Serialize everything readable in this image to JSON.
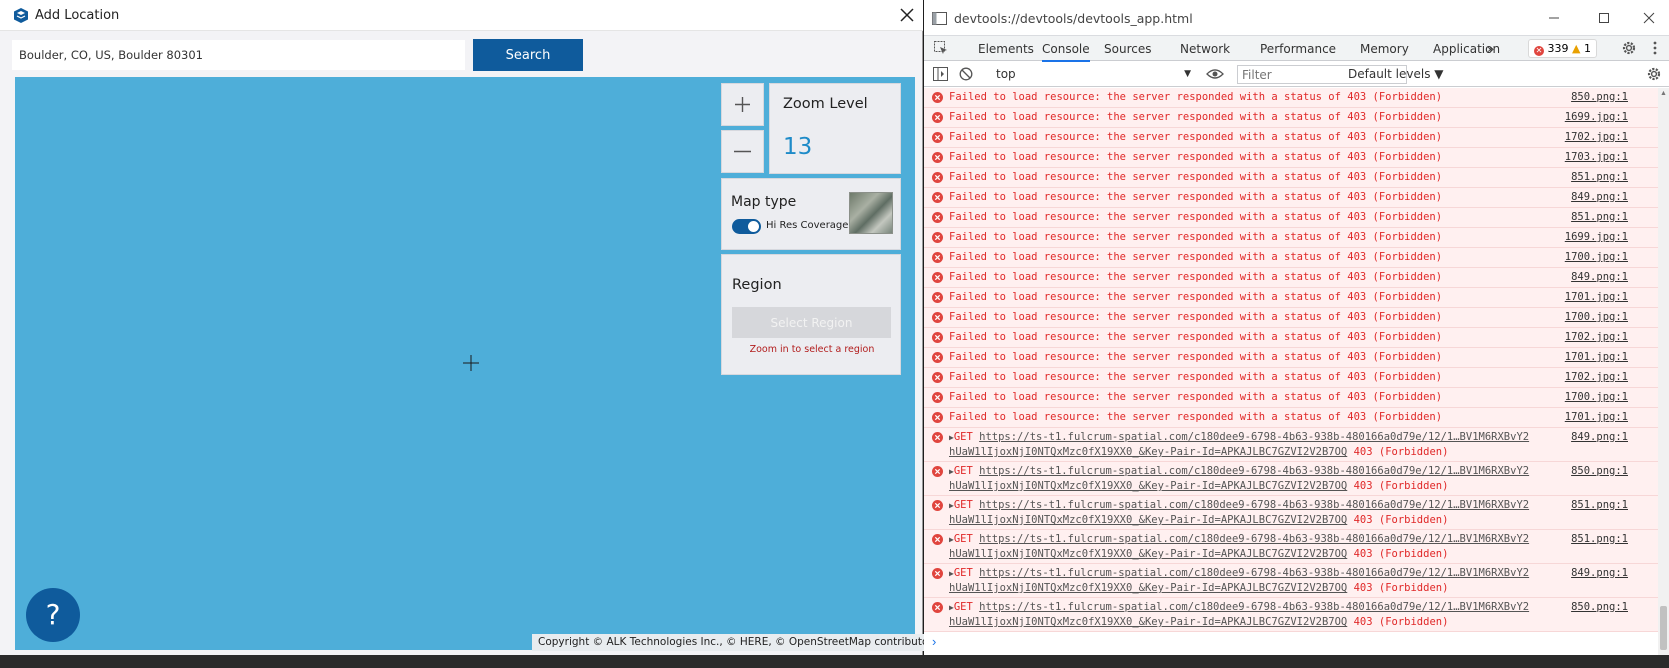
{
  "left_window": {
    "title": "Add Location",
    "search": {
      "value": "Boulder, CO, US, Boulder 80301",
      "button_label": "Search"
    },
    "zoom": {
      "in_symbol": "+",
      "out_symbol": "—",
      "label": "Zoom Level",
      "value": "13"
    },
    "map_type": {
      "label": "Map type",
      "toggle_label": "Hi Res Coverage",
      "toggle_on": true
    },
    "region": {
      "label": "Region",
      "button_label": "Select Region",
      "hint": "Zoom in to select a region"
    },
    "help_symbol": "?",
    "copyright": "Copyright © ALK Technologies Inc., © HERE, © OpenStreetMap contributors",
    "colors": {
      "map_water": "#4eaed9",
      "primary": "#0f5b9c",
      "zoom_value": "#1e8bc8"
    }
  },
  "devtools": {
    "title": "devtools://devtools/devtools_app.html",
    "tabs": [
      "Elements",
      "Console",
      "Sources",
      "Network",
      "Performance",
      "Memory",
      "Application"
    ],
    "active_tab": "Console",
    "more_tabs": "»",
    "error_count": "339",
    "warning_count": "1",
    "context": "top",
    "filter_placeholder": "Filter",
    "levels": "Default levels ▼",
    "errors": [
      {
        "message": "Failed to load resource: the server responded with a status of 403 (Forbidden)",
        "source": "850.png:1"
      },
      {
        "message": "Failed to load resource: the server responded with a status of 403 (Forbidden)",
        "source": "1699.jpg:1"
      },
      {
        "message": "Failed to load resource: the server responded with a status of 403 (Forbidden)",
        "source": "1702.jpg:1"
      },
      {
        "message": "Failed to load resource: the server responded with a status of 403 (Forbidden)",
        "source": "1703.jpg:1"
      },
      {
        "message": "Failed to load resource: the server responded with a status of 403 (Forbidden)",
        "source": "851.png:1"
      },
      {
        "message": "Failed to load resource: the server responded with a status of 403 (Forbidden)",
        "source": "849.png:1"
      },
      {
        "message": "Failed to load resource: the server responded with a status of 403 (Forbidden)",
        "source": "851.png:1"
      },
      {
        "message": "Failed to load resource: the server responded with a status of 403 (Forbidden)",
        "source": "1699.jpg:1"
      },
      {
        "message": "Failed to load resource: the server responded with a status of 403 (Forbidden)",
        "source": "1700.jpg:1"
      },
      {
        "message": "Failed to load resource: the server responded with a status of 403 (Forbidden)",
        "source": "849.png:1"
      },
      {
        "message": "Failed to load resource: the server responded with a status of 403 (Forbidden)",
        "source": "1701.jpg:1"
      },
      {
        "message": "Failed to load resource: the server responded with a status of 403 (Forbidden)",
        "source": "1700.jpg:1"
      },
      {
        "message": "Failed to load resource: the server responded with a status of 403 (Forbidden)",
        "source": "1702.jpg:1"
      },
      {
        "message": "Failed to load resource: the server responded with a status of 403 (Forbidden)",
        "source": "1701.jpg:1"
      },
      {
        "message": "Failed to load resource: the server responded with a status of 403 (Forbidden)",
        "source": "1702.jpg:1"
      },
      {
        "message": "Failed to load resource: the server responded with a status of 403 (Forbidden)",
        "source": "1700.jpg:1"
      },
      {
        "message": "Failed to load resource: the server responded with a status of 403 (Forbidden)",
        "source": "1701.jpg:1"
      }
    ],
    "get_errors": [
      {
        "method": "GET",
        "url": "https://ts-t1.fulcrum-spatial.com/c180dee9-6798-4b63-938b-480166a0d79e/12/1…BV1M6RXBvY2",
        "url_cont": "hUaW1lIjoxNjI0NTQxMzc0fX19XX0_&Key-Pair-Id=APKAJLBC7GZVI2V2B7OQ",
        "status": "403 (Forbidden)",
        "source": "849.png:1"
      },
      {
        "method": "GET",
        "url": "https://ts-t1.fulcrum-spatial.com/c180dee9-6798-4b63-938b-480166a0d79e/12/1…BV1M6RXBvY2",
        "url_cont": "hUaW1lIjoxNjI0NTQxMzc0fX19XX0_&Key-Pair-Id=APKAJLBC7GZVI2V2B7OQ",
        "status": "403 (Forbidden)",
        "source": "850.png:1"
      },
      {
        "method": "GET",
        "url": "https://ts-t1.fulcrum-spatial.com/c180dee9-6798-4b63-938b-480166a0d79e/12/1…BV1M6RXBvY2",
        "url_cont": "hUaW1lIjoxNjI0NTQxMzc0fX19XX0_&Key-Pair-Id=APKAJLBC7GZVI2V2B7OQ",
        "status": "403 (Forbidden)",
        "source": "851.png:1"
      },
      {
        "method": "GET",
        "url": "https://ts-t1.fulcrum-spatial.com/c180dee9-6798-4b63-938b-480166a0d79e/12/1…BV1M6RXBvY2",
        "url_cont": "hUaW1lIjoxNjI0NTQxMzc0fX19XX0_&Key-Pair-Id=APKAJLBC7GZVI2V2B7OQ",
        "status": "403 (Forbidden)",
        "source": "851.png:1"
      },
      {
        "method": "GET",
        "url": "https://ts-t1.fulcrum-spatial.com/c180dee9-6798-4b63-938b-480166a0d79e/12/1…BV1M6RXBvY2",
        "url_cont": "hUaW1lIjoxNjI0NTQxMzc0fX19XX0_&Key-Pair-Id=APKAJLBC7GZVI2V2B7OQ",
        "status": "403 (Forbidden)",
        "source": "849.png:1"
      },
      {
        "method": "GET",
        "url": "https://ts-t1.fulcrum-spatial.com/c180dee9-6798-4b63-938b-480166a0d79e/12/1…BV1M6RXBvY2",
        "url_cont": "hUaW1lIjoxNjI0NTQxMzc0fX19XX0_&Key-Pair-Id=APKAJLBC7GZVI2V2B7OQ",
        "status": "403 (Forbidden)",
        "source": "850.png:1"
      }
    ],
    "prompt_symbol": "›"
  }
}
